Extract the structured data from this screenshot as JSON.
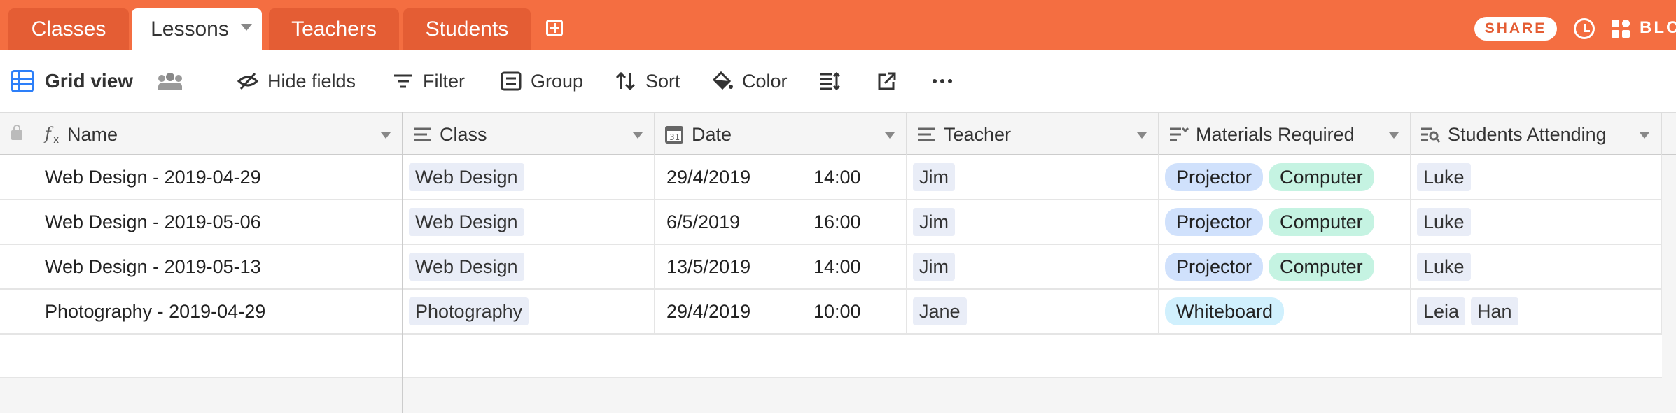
{
  "tabs": [
    {
      "label": "Classes"
    },
    {
      "label": "Lessons"
    },
    {
      "label": "Teachers"
    },
    {
      "label": "Students"
    }
  ],
  "header_actions": {
    "share_label": "SHARE",
    "blocks_label": "BLO"
  },
  "toolbar": {
    "view_name": "Grid view",
    "hide_fields": "Hide fields",
    "filter": "Filter",
    "group": "Group",
    "sort": "Sort",
    "color": "Color"
  },
  "columns": [
    {
      "label": "Name",
      "icon": "formula-icon"
    },
    {
      "label": "Class",
      "icon": "link-icon"
    },
    {
      "label": "Date",
      "icon": "calendar-icon"
    },
    {
      "label": "Teacher",
      "icon": "link-icon"
    },
    {
      "label": "Materials Required",
      "icon": "multiselect-icon"
    },
    {
      "label": "Students Attending",
      "icon": "lookup-icon"
    }
  ],
  "rows": [
    {
      "name": "Web Design - 2019-04-29",
      "class": "Web Design",
      "date": "29/4/2019",
      "time": "14:00",
      "teacher": "Jim",
      "materials": [
        "Projector",
        "Computer"
      ],
      "students": [
        "Luke"
      ]
    },
    {
      "name": "Web Design - 2019-05-06",
      "class": "Web Design",
      "date": "6/5/2019",
      "time": "16:00",
      "teacher": "Jim",
      "materials": [
        "Projector",
        "Computer"
      ],
      "students": [
        "Luke"
      ]
    },
    {
      "name": "Web Design - 2019-05-13",
      "class": "Web Design",
      "date": "13/5/2019",
      "time": "14:00",
      "teacher": "Jim",
      "materials": [
        "Projector",
        "Computer"
      ],
      "students": [
        "Luke"
      ]
    },
    {
      "name": "Photography - 2019-04-29",
      "class": "Photography",
      "date": "29/4/2019",
      "time": "10:00",
      "teacher": "Jane",
      "materials": [
        "Whiteboard"
      ],
      "students": [
        "Leia",
        "Han"
      ]
    }
  ],
  "material_colors": {
    "Projector": "blue",
    "Computer": "green",
    "Whiteboard": "cyan"
  },
  "colors": {
    "topbar": "#f46e41",
    "tab_inactive": "#e45d34",
    "accent": "#2d7ff9"
  }
}
